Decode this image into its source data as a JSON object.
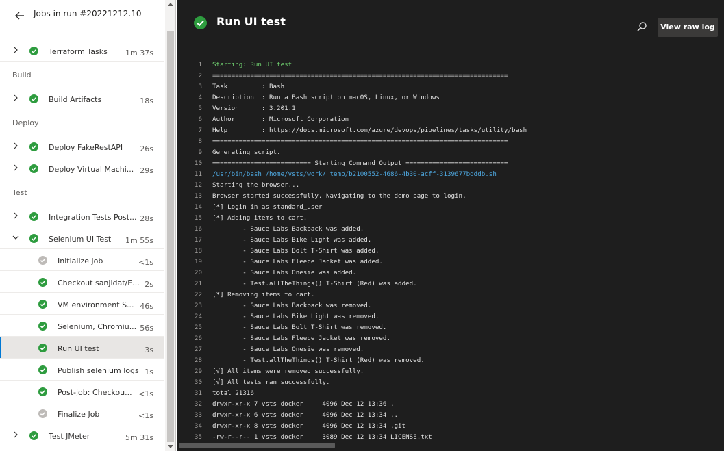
{
  "left_panel": {
    "title": "Jobs in run #20221212.10",
    "jobs": [
      {
        "label": "Terraform Tasks",
        "duration": "1m 37s",
        "status": "success",
        "expanded": false
      },
      {
        "section": "Build"
      },
      {
        "label": "Build Artifacts",
        "duration": "18s",
        "status": "success",
        "expanded": false
      },
      {
        "section": "Deploy"
      },
      {
        "label": "Deploy FakeRestAPI",
        "duration": "26s",
        "status": "success",
        "expanded": false
      },
      {
        "label": "Deploy Virtual Machi...",
        "duration": "29s",
        "status": "success",
        "expanded": false
      },
      {
        "section": "Test"
      },
      {
        "label": "Integration Tests Post...",
        "duration": "28s",
        "status": "success",
        "expanded": false
      },
      {
        "label": "Selenium UI Test",
        "duration": "1m 55s",
        "status": "success",
        "expanded": true,
        "steps": [
          {
            "label": "Initialize job",
            "duration": "<1s",
            "status": "skipped"
          },
          {
            "label": "Checkout sanjidat/E...",
            "duration": "2s",
            "status": "success"
          },
          {
            "label": "VM environment S...",
            "duration": "46s",
            "status": "success"
          },
          {
            "label": "Selenium, Chromiu...",
            "duration": "56s",
            "status": "success"
          },
          {
            "label": "Run UI test",
            "duration": "3s",
            "status": "success",
            "selected": true
          },
          {
            "label": "Publish selenium logs",
            "duration": "1s",
            "status": "success"
          },
          {
            "label": "Post-job: Checkou...",
            "duration": "<1s",
            "status": "success"
          },
          {
            "label": "Finalize Job",
            "duration": "<1s",
            "status": "skipped"
          }
        ]
      },
      {
        "label": "Test JMeter",
        "duration": "5m 31s",
        "status": "success",
        "expanded": false
      }
    ]
  },
  "log_panel": {
    "title": "Run UI test",
    "raw_log_label": "View raw log",
    "search_icon": "search-icon",
    "lines": [
      {
        "n": "1",
        "text": "Starting: Run UI test",
        "style": "green"
      },
      {
        "n": "2",
        "text": "==============================================================================",
        "style": "normal"
      },
      {
        "n": "3",
        "text": "Task         : Bash",
        "style": "normal"
      },
      {
        "n": "4",
        "text": "Description  : Run a Bash script on macOS, Linux, or Windows",
        "style": "normal"
      },
      {
        "n": "5",
        "text": "Version      : 3.201.1",
        "style": "normal"
      },
      {
        "n": "6",
        "text": "Author       : Microsoft Corporation",
        "style": "normal"
      },
      {
        "n": "7",
        "text": "Help         : https://docs.microsoft.com/azure/devops/pipelines/tasks/utility/bash",
        "style": "help"
      },
      {
        "n": "8",
        "text": "==============================================================================",
        "style": "normal"
      },
      {
        "n": "9",
        "text": "Generating script.",
        "style": "normal"
      },
      {
        "n": "10",
        "text": "========================== Starting Command Output ===========================",
        "style": "normal"
      },
      {
        "n": "11",
        "text": "/usr/bin/bash /home/vsts/work/_temp/b2100552-4686-4b30-acff-3139677bdddb.sh",
        "style": "blue"
      },
      {
        "n": "12",
        "text": "Starting the browser...",
        "style": "normal"
      },
      {
        "n": "13",
        "text": "Browser started successfully. Navigating to the demo page to login.",
        "style": "normal"
      },
      {
        "n": "14",
        "text": "[*] Login in as standard_user",
        "style": "normal"
      },
      {
        "n": "15",
        "text": "[*] Adding items to cart.",
        "style": "normal"
      },
      {
        "n": "16",
        "text": "        - Sauce Labs Backpack was added.",
        "style": "normal"
      },
      {
        "n": "17",
        "text": "        - Sauce Labs Bike Light was added.",
        "style": "normal"
      },
      {
        "n": "18",
        "text": "        - Sauce Labs Bolt T-Shirt was added.",
        "style": "normal"
      },
      {
        "n": "19",
        "text": "        - Sauce Labs Fleece Jacket was added.",
        "style": "normal"
      },
      {
        "n": "20",
        "text": "        - Sauce Labs Onesie was added.",
        "style": "normal"
      },
      {
        "n": "21",
        "text": "        - Test.allTheThings() T-Shirt (Red) was added.",
        "style": "normal"
      },
      {
        "n": "22",
        "text": "[*] Removing items to cart.",
        "style": "normal"
      },
      {
        "n": "23",
        "text": "        - Sauce Labs Backpack was removed.",
        "style": "normal"
      },
      {
        "n": "24",
        "text": "        - Sauce Labs Bike Light was removed.",
        "style": "normal"
      },
      {
        "n": "25",
        "text": "        - Sauce Labs Bolt T-Shirt was removed.",
        "style": "normal"
      },
      {
        "n": "26",
        "text": "        - Sauce Labs Fleece Jacket was removed.",
        "style": "normal"
      },
      {
        "n": "27",
        "text": "        - Sauce Labs Onesie was removed.",
        "style": "normal"
      },
      {
        "n": "28",
        "text": "        - Test.allTheThings() T-Shirt (Red) was removed.",
        "style": "normal"
      },
      {
        "n": "29",
        "text": "[√] All items were removed successfully.",
        "style": "normal"
      },
      {
        "n": "30",
        "text": "[√] All tests ran successfully.",
        "style": "normal"
      },
      {
        "n": "31",
        "text": "total 21316",
        "style": "normal"
      },
      {
        "n": "32",
        "text": "drwxr-xr-x 7 vsts docker     4096 Dec 12 13:36 .",
        "style": "normal"
      },
      {
        "n": "33",
        "text": "drwxr-xr-x 6 vsts docker     4096 Dec 12 13:34 ..",
        "style": "normal"
      },
      {
        "n": "34",
        "text": "drwxr-xr-x 8 vsts docker     4096 Dec 12 13:34 .git",
        "style": "normal"
      },
      {
        "n": "35",
        "text": "-rw-r--r-- 1 vsts docker     3089 Dec 12 13:34 LICENSE.txt",
        "style": "normal"
      }
    ]
  },
  "colors": {
    "success": "#2e9c3f",
    "skipped": "#bebbb8",
    "log_background": "#1e1e1e",
    "selected_accent": "#0078d4"
  }
}
